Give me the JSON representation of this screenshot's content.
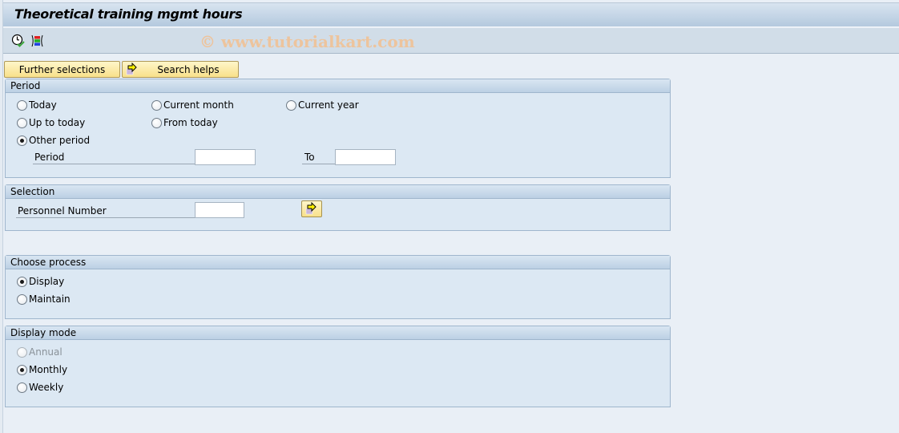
{
  "window": {
    "title": "Theoretical training mgmt hours",
    "watermark": "© www.tutorialkart.com"
  },
  "toolbar": {
    "icons": [
      {
        "name": "execute-clock-icon",
        "tooltip": ""
      },
      {
        "name": "selection-variant-icon",
        "tooltip": ""
      }
    ]
  },
  "buttons": {
    "further_selections": "Further selections",
    "search_helps": "Search helps"
  },
  "period": {
    "title": "Period",
    "options": [
      {
        "label": "Today",
        "checked": false
      },
      {
        "label": "Current month",
        "checked": false
      },
      {
        "label": "Current year",
        "checked": false
      },
      {
        "label": "Up to today",
        "checked": false
      },
      {
        "label": "From today",
        "checked": false
      },
      {
        "label": "Other period",
        "checked": true
      }
    ],
    "period_label": "Period",
    "period_from_value": "",
    "to_label": "To",
    "period_to_value": ""
  },
  "selection": {
    "title": "Selection",
    "personnel_number_label": "Personnel Number",
    "personnel_number_value": ""
  },
  "process": {
    "title": "Choose process",
    "options": [
      {
        "label": "Display",
        "checked": true
      },
      {
        "label": "Maintain",
        "checked": false
      }
    ]
  },
  "display_mode": {
    "title": "Display mode",
    "options": [
      {
        "label": "Annual",
        "checked": false,
        "disabled": true
      },
      {
        "label": "Monthly",
        "checked": true
      },
      {
        "label": "Weekly",
        "checked": false
      }
    ]
  },
  "colors": {
    "button_yellow": "#f8e08a",
    "group_bg": "#dce8f3",
    "watermark": "#efc39a"
  }
}
